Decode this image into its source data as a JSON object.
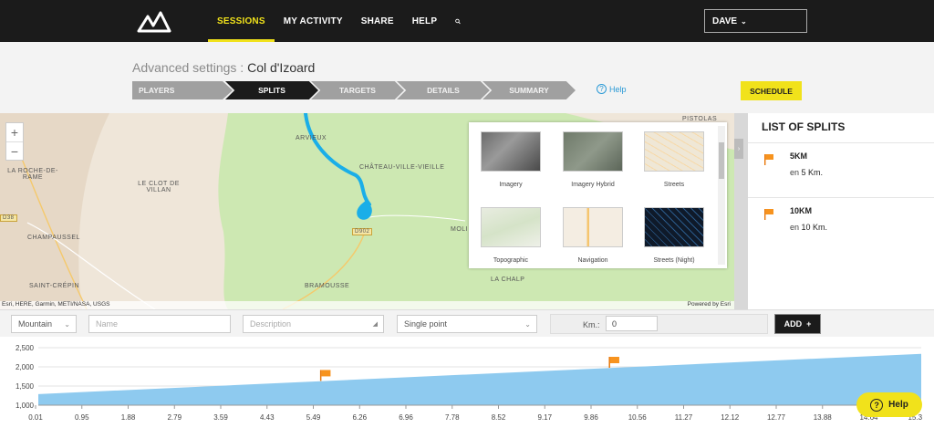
{
  "nav": {
    "items": [
      "SESSIONS",
      "MY ACTIVITY",
      "SHARE",
      "HELP"
    ],
    "active": "SESSIONS",
    "search_icon": "search-icon",
    "user": "DAVE"
  },
  "page": {
    "title_prefix": "Advanced settings : ",
    "title_name": "Col d'Izoard",
    "steps": [
      "PLAYERS",
      "SPLITS",
      "TARGETS",
      "DETAILS",
      "SUMMARY"
    ],
    "active_step": "SPLITS",
    "help_label": "Help",
    "schedule_label": "SCHEDULE"
  },
  "map": {
    "labels": [
      "ARVIEUX",
      "CHÂTEAU-VILLE-VIEILLE",
      "LE CLOT DE VILLAN",
      "LA ROCHE-DE-RAME",
      "CHAMPAUSSEL",
      "SAINT-CRÉPIN",
      "BRAMOUSSE",
      "LA CHALP",
      "MOLI",
      "PISTOLAS",
      "D902",
      "D38"
    ],
    "attribution_left": "Esri, HERE, Garmin, METI/NASA, USGS",
    "attribution_right": "Powered by Esri",
    "basemaps": [
      "Imagery",
      "Imagery Hybrid",
      "Streets",
      "Topographic",
      "Navigation",
      "Streets (Night)"
    ]
  },
  "splits": {
    "title": "LIST OF SPLITS",
    "items": [
      {
        "name": "5KM",
        "prefix": "en ",
        "value": "5 Km."
      },
      {
        "name": "10KM",
        "prefix": "en ",
        "value": "10 Km."
      }
    ]
  },
  "form": {
    "type_value": "Mountain",
    "name_placeholder": "Name",
    "description_placeholder": "Description",
    "mode_value": "Single point",
    "km_label": "Km.:",
    "km_value": "0",
    "add_label": "ADD"
  },
  "chart_data": {
    "type": "area",
    "x_ticks": [
      "0.01",
      "0.95",
      "1.88",
      "2.79",
      "3.59",
      "4.43",
      "5.49",
      "6.26",
      "6.96",
      "7.78",
      "8.52",
      "9.17",
      "9.86",
      "10.56",
      "11.27",
      "12.12",
      "12.77",
      "13.88",
      "14.64",
      "15.3"
    ],
    "y_ticks": [
      "2,500",
      "2,000",
      "1,500",
      "1,000"
    ],
    "ylim": [
      1000,
      2500
    ],
    "x": [
      0.01,
      15.3
    ],
    "y": [
      1290,
      2340
    ],
    "flags_km": [
      5,
      10
    ],
    "fill_color": "#8ecaef"
  },
  "help_float": "Help"
}
